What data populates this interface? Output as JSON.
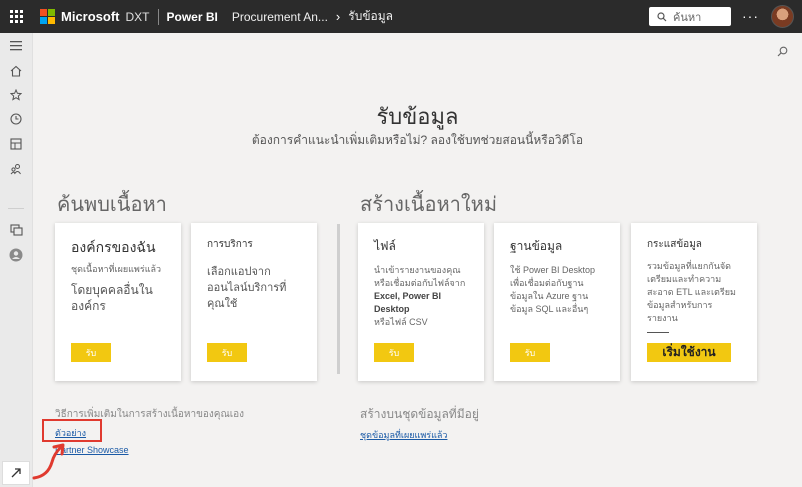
{
  "topbar": {
    "brand": "Microsoft",
    "tenant": "DXT",
    "product": "Power BI",
    "breadcrumb_workspace": "Procurement An...",
    "breadcrumb_page": "รับข้อมูล",
    "search_placeholder": "ค้นหา",
    "more": "···",
    "ms_colors": [
      "#f25022",
      "#7fba00",
      "#00a4ef",
      "#ffb900"
    ]
  },
  "rail": {
    "icons": [
      "hamburger-icon",
      "home-icon",
      "star-icon",
      "clock-icon",
      "apps-icon",
      "shared-icon",
      "workspaces-icon",
      "my-workspace-icon",
      "expand-icon"
    ]
  },
  "heading": {
    "title": "รับข้อมูล",
    "subtitle": "ต้องการคำแนะนำเพิ่มเติมหรือไม่? ลองใช้บทช่วยสอนนี้หรือวิดีโอ"
  },
  "discover": {
    "title": "ค้นพบเนื้อหา",
    "cards": [
      {
        "title": "องค์กรของฉัน",
        "desc": "ชุดเนื้อหาที่เผยแพร่แล้ว",
        "big": "โดยบุคคลอื่นในองค์กร",
        "button": "รับ"
      },
      {
        "title": "การบริการ",
        "desc": "",
        "big": "เลือกแอปจากออนไลน์บริการที่คุณใช้",
        "button": "รับ"
      }
    ]
  },
  "create": {
    "title": "สร้างเนื้อหาใหม่",
    "cards": [
      {
        "title": "ไฟล์",
        "desc": "นำเข้ารายงานของคุณ หรือเชื่อมต่อกับไฟล์จาก",
        "bold": "Excel, Power BI Desktop",
        "desc2": "หรือไฟล์ CSV",
        "button": "รับ"
      },
      {
        "title": "ฐานข้อมูล",
        "desc": "ใช้ Power BI Desktop เพื่อเชื่อมต่อกับฐานข้อมูลใน Azure ฐานข้อมูล SQL และอื่นๆ",
        "button": "รับ"
      },
      {
        "title": "กระแสข้อมูล",
        "desc": "รวมข้อมูลที่แยกกันจัดเตรียมและทำความสะอาด ETL และเตรียมข้อมูลสำหรับการรายงาน",
        "button": "เริ่มใช้งาน"
      }
    ]
  },
  "bottom": {
    "more_ways": "วิธีการเพิ่มเติมในการสร้างเนื้อหาของคุณเอง",
    "samples_link": "ตัวอย่าง",
    "showcase_link": "Partner Showcase",
    "create_existing": "สร้างบนชุดข้อมูลที่มีอยู่",
    "published_datasets_link": "ชุดข้อมูลที่เผยแพร่แล้ว"
  },
  "colors": {
    "accent": "#f2c811",
    "highlight": "#e03a2f",
    "topbar": "#2b2b2b",
    "link": "#1a5aa6"
  }
}
